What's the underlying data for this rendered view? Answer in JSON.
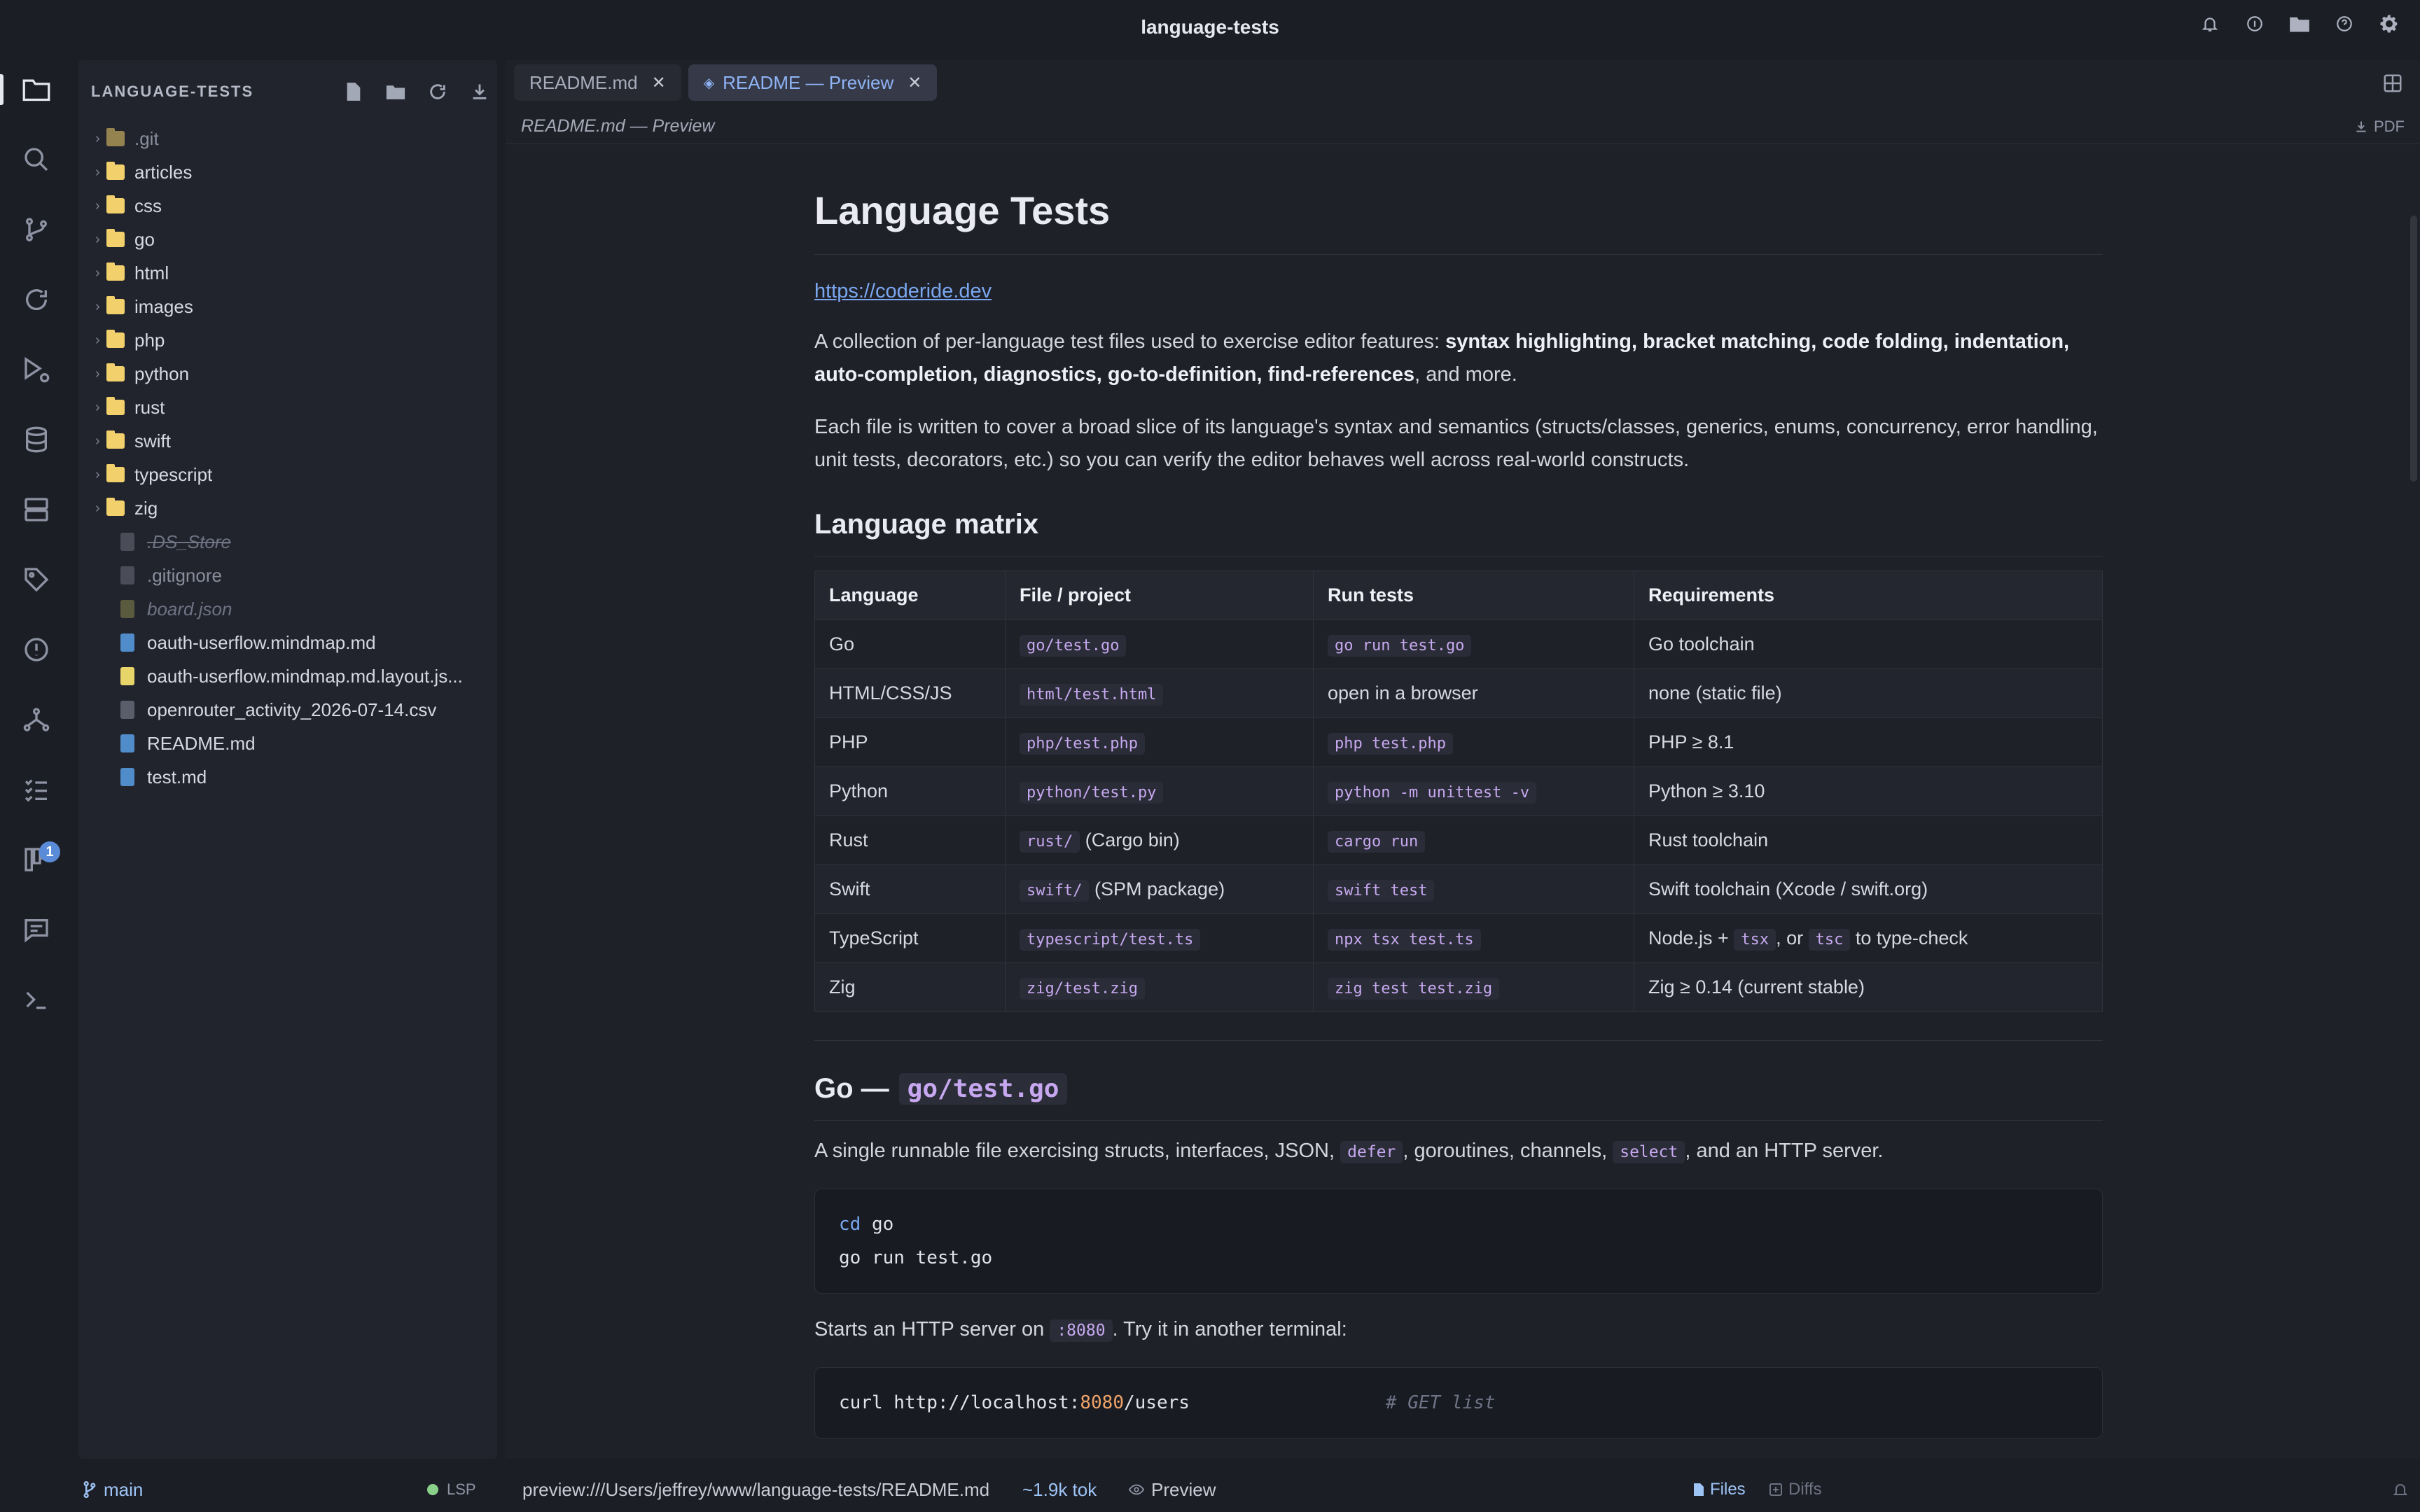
{
  "window": {
    "title": "language-tests"
  },
  "titlebar_icons": [
    "bell-icon",
    "circle-info-icon",
    "folder-icon",
    "help-icon",
    "gear-icon"
  ],
  "activity": {
    "badge": "1"
  },
  "sidebar": {
    "header": "LANGUAGE-TESTS",
    "items": [
      {
        "name": ".git",
        "type": "folder",
        "style": "dim"
      },
      {
        "name": "articles",
        "type": "folder"
      },
      {
        "name": "css",
        "type": "folder"
      },
      {
        "name": "go",
        "type": "folder"
      },
      {
        "name": "html",
        "type": "folder"
      },
      {
        "name": "images",
        "type": "folder"
      },
      {
        "name": "php",
        "type": "folder"
      },
      {
        "name": "python",
        "type": "folder"
      },
      {
        "name": "rust",
        "type": "folder"
      },
      {
        "name": "swift",
        "type": "folder"
      },
      {
        "name": "typescript",
        "type": "folder"
      },
      {
        "name": "zig",
        "type": "folder"
      },
      {
        "name": ".DS_Store",
        "type": "file",
        "style": "ghost",
        "color": "#4a4d58"
      },
      {
        "name": ".gitignore",
        "type": "file",
        "style": "dim",
        "color": "#4a4d58"
      },
      {
        "name": "board.json",
        "type": "file",
        "style": "ghost2",
        "color": "#5a5a3e"
      },
      {
        "name": "oauth-userflow.mindmap.md",
        "type": "file",
        "color": "#4f8cc9"
      },
      {
        "name": "oauth-userflow.mindmap.md.layout.js...",
        "type": "file",
        "color": "#e8d56a"
      },
      {
        "name": "openrouter_activity_2026-07-14.csv",
        "type": "file",
        "color": "#5a5e6b"
      },
      {
        "name": "README.md",
        "type": "file",
        "color": "#4f8cc9"
      },
      {
        "name": "test.md",
        "type": "file",
        "color": "#4f8cc9"
      }
    ]
  },
  "tabs": [
    {
      "label": "README.md",
      "active": false
    },
    {
      "label": "README — Preview",
      "active": true
    }
  ],
  "crumb": "README.md — Preview",
  "pdf_label": "PDF",
  "doc": {
    "title": "Language Tests",
    "link": "https://coderide.dev",
    "intro_start": "A collection of per-language test files used to exercise editor features: ",
    "intro_bold": "syntax highlighting, bracket matching, code folding, indentation, auto-completion, diagnostics, go-to-definition, find-references",
    "intro_end": ", and more.",
    "para2": "Each file is written to cover a broad slice of its language's syntax and semantics (structs/classes, generics, enums, concurrency, error handling, unit tests, decorators, etc.) so you can verify the editor behaves well across real-world constructs.",
    "matrix_heading": "Language matrix",
    "matrix_headers": [
      "Language",
      "File / project",
      "Run tests",
      "Requirements"
    ],
    "matrix_rows": [
      {
        "lang": "Go",
        "file": "go/test.go",
        "file_extra": "",
        "run": "go run test.go",
        "run_plain": "",
        "req": "Go toolchain"
      },
      {
        "lang": "HTML/CSS/JS",
        "file": "html/test.html",
        "file_extra": "",
        "run": "",
        "run_plain": "open in a browser",
        "req": "none (static file)"
      },
      {
        "lang": "PHP",
        "file": "php/test.php",
        "file_extra": "",
        "run": "php test.php",
        "run_plain": "",
        "req": "PHP ≥ 8.1"
      },
      {
        "lang": "Python",
        "file": "python/test.py",
        "file_extra": "",
        "run": "python -m unittest -v",
        "run_plain": "",
        "req": "Python ≥ 3.10"
      },
      {
        "lang": "Rust",
        "file": "rust/",
        "file_extra": "(Cargo bin)",
        "run": "cargo run",
        "run_plain": "",
        "req": "Rust toolchain"
      },
      {
        "lang": "Swift",
        "file": "swift/",
        "file_extra": "(SPM package)",
        "run": "swift test",
        "run_plain": "",
        "req": "Swift toolchain (Xcode / swift.org)"
      },
      {
        "lang": "TypeScript",
        "file": "typescript/test.ts",
        "file_extra": "",
        "run": "npx tsx test.ts",
        "run_plain": "",
        "req": "TS_SPECIAL"
      },
      {
        "lang": "Zig",
        "file": "zig/test.zig",
        "file_extra": "",
        "run": "zig test test.zig",
        "run_plain": "",
        "req": "Zig ≥ 0.14 (current stable)"
      }
    ],
    "ts_req": {
      "a": "Node.js + ",
      "b": "tsx",
      "c": ", or ",
      "d": "tsc",
      "e": " to type-check"
    },
    "go_heading": "Go —",
    "go_heading_code": "go/test.go",
    "go_para": {
      "a": "A single runnable file exercising structs, interfaces, JSON, ",
      "b": "defer",
      "c": ", goroutines, channels, ",
      "d": "select",
      "e": ", and an HTTP server."
    },
    "go_code": {
      "kw": "cd",
      "l1": " go",
      "l2": "go run test.go"
    },
    "http_para": {
      "a": "Starts an HTTP server on ",
      "b": ":8080",
      "c": ". Try it in another terminal:"
    },
    "curl": {
      "a": "curl http://localhost:",
      "port": "8080",
      "b": "/users",
      "comment": "# GET list"
    }
  },
  "status": {
    "branch": "main",
    "lsp": "LSP",
    "path": "preview:///Users/jeffrey/www/language-tests/README.md",
    "tokens": "~1.9k tok",
    "preview": "Preview",
    "files": "Files",
    "diffs": "Diffs"
  }
}
